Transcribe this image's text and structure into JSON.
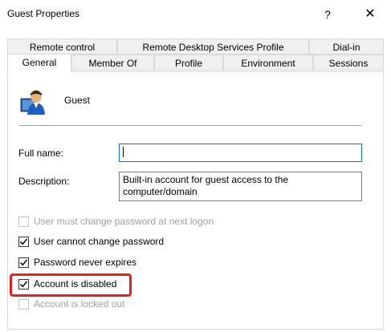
{
  "window": {
    "title": "Guest Properties",
    "help_label": "?",
    "close_label": "✕"
  },
  "tabs": {
    "row1": [
      "Remote control",
      "Remote Desktop Services Profile",
      "Dial-in"
    ],
    "row2": [
      "General",
      "Member Of",
      "Profile",
      "Environment",
      "Sessions"
    ],
    "active": "General"
  },
  "general": {
    "username": "Guest",
    "user_icon": "user-icon",
    "full_name_label": "Full name:",
    "full_name_value": "",
    "description_label": "Description:",
    "description_value": "Built-in account for guest access to the computer/domain",
    "checkboxes": [
      {
        "label": "User must change password at next logon",
        "checked": false,
        "enabled": false
      },
      {
        "label": "User cannot change password",
        "checked": true,
        "enabled": true
      },
      {
        "label": "Password never expires",
        "checked": true,
        "enabled": true
      },
      {
        "label": "Account is disabled",
        "checked": true,
        "enabled": true,
        "highlighted": true
      },
      {
        "label": "Account is locked out",
        "checked": false,
        "enabled": false
      }
    ]
  },
  "colors": {
    "highlight": "#e8201c",
    "focus_border": "#0078d7",
    "disabled_text": "#a0a0a0"
  }
}
